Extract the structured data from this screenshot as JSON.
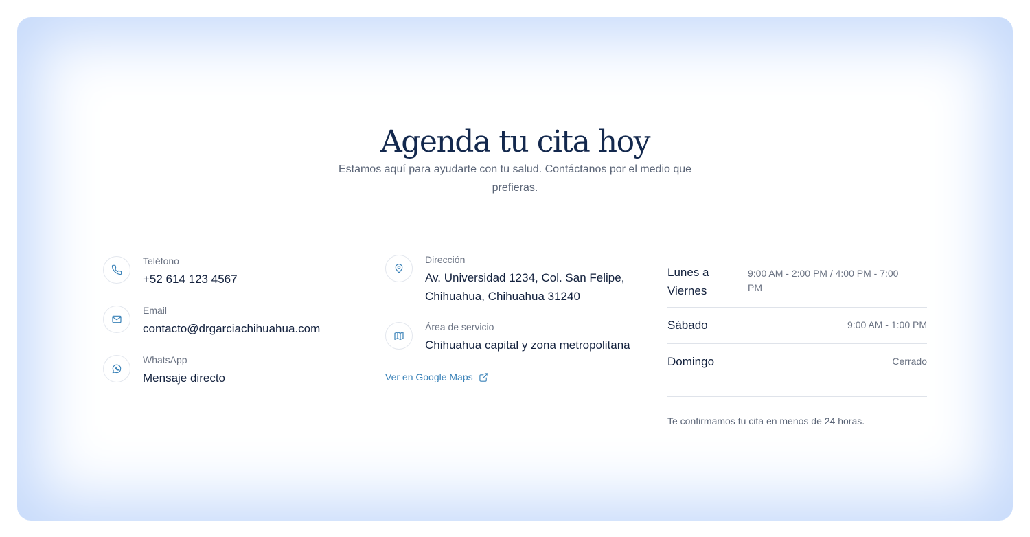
{
  "header": {
    "title": "Agenda tu cita hoy",
    "subtitle": "Estamos aquí para ayudarte con tu salud. Contáctanos por el medio que prefieras."
  },
  "contact": {
    "phone": {
      "label": "Teléfono",
      "value": "+52 614 123 4567",
      "icon": "phone-icon"
    },
    "email": {
      "label": "Email",
      "value": "contacto@drgarciachihuahua.com",
      "icon": "mail-icon"
    },
    "whatsapp": {
      "label": "WhatsApp",
      "value": "Mensaje directo",
      "icon": "whatsapp-icon"
    }
  },
  "location": {
    "address": {
      "label": "Dirección",
      "line1": "Av. Universidad 1234, Col. San Felipe,",
      "line2": "Chihuahua, Chihuahua 31240",
      "icon": "map-pin-icon"
    },
    "service_area": {
      "label": "Área de servicio",
      "value": "Chihuahua capital y zona metropolitana",
      "icon": "map-icon"
    },
    "maps_link": {
      "label": "Ver en Google Maps",
      "icon": "external-link-icon"
    }
  },
  "hours": {
    "rows": [
      {
        "day_line1": "Lunes a",
        "day_line2": "Viernes",
        "time_line1": "9:00 AM - 2:00 PM / 4:00 PM - 7:00",
        "time_line2": "PM"
      },
      {
        "day": "Sábado",
        "time": "9:00 AM - 1:00 PM"
      },
      {
        "day": "Domingo",
        "time": "Cerrado"
      }
    ],
    "note": "Te confirmamos tu cita en menos de 24 horas."
  },
  "colors": {
    "title": "#13284d",
    "accent": "#3a82b8",
    "card_glow": "#c6dafb",
    "muted_text": "#6b7383"
  }
}
